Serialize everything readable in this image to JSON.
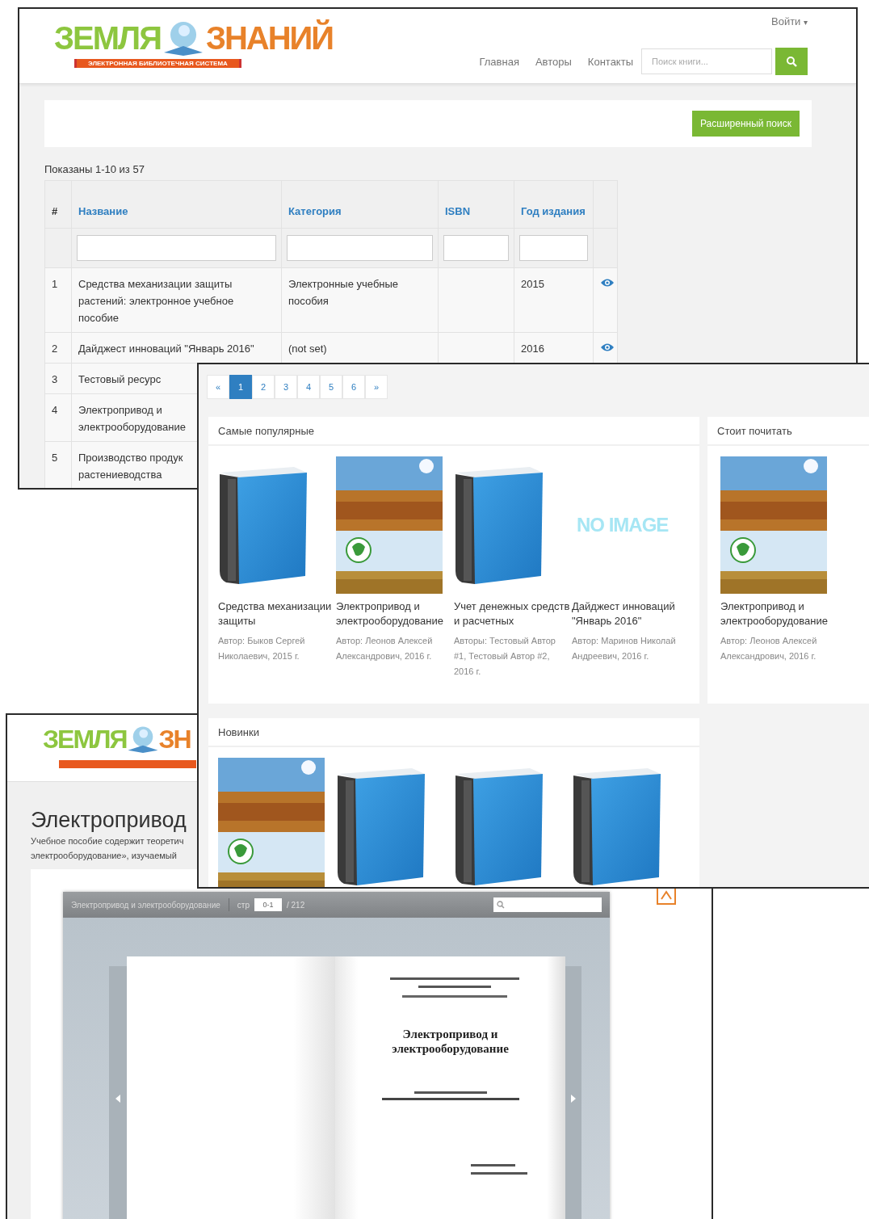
{
  "catalog_window": {
    "logo": {
      "first_word": "ЗЕМЛЯ",
      "second_word": "ЗНАНИЙ",
      "tagline": "ЭЛЕКТРОННАЯ БИБЛИОТЕЧНАЯ СИСТЕМА"
    },
    "login": "Войти",
    "login_caret": "▾",
    "nav": [
      "Главная",
      "Авторы",
      "Контакты"
    ],
    "search": {
      "placeholder": "Поиск книги..."
    },
    "advanced_search_button": "Расширенный поиск",
    "summary": "Показаны 1-10 из 57",
    "table": {
      "columns": [
        "#",
        "Название",
        "Категория",
        "ISBN",
        "Год издания"
      ],
      "rows": [
        {
          "num": "1",
          "title": "Средства механизации защиты растений: электронное учебное пособие",
          "category": "Электронные учебные пособия",
          "year": "2015"
        },
        {
          "num": "2",
          "title": "Дайджест инноваций \"Январь 2016\"",
          "category": "(not set)",
          "year": "2016"
        },
        {
          "num": "3",
          "title": "Тестовый ресурс"
        },
        {
          "num": "4",
          "title": "Электропривод и электрооборудование"
        },
        {
          "num": "5",
          "title": "Производство продук растениеводства"
        }
      ]
    }
  },
  "listing_window": {
    "pagination": [
      {
        "label": "«",
        "selected": false
      },
      {
        "label": "1",
        "selected": true
      },
      {
        "label": "2",
        "selected": false
      },
      {
        "label": "3",
        "selected": false
      },
      {
        "label": "4",
        "selected": false
      },
      {
        "label": "5",
        "selected": false
      },
      {
        "label": "6",
        "selected": false
      },
      {
        "label": "»",
        "selected": false
      }
    ],
    "panels": [
      {
        "title": "Самые популярные",
        "books": [
          {
            "kind": "blue_book",
            "title": "Средства механизации защиты",
            "author": "Автор: Быков Сергей Николаевич, 2015 г."
          },
          {
            "kind": "cover",
            "title": "Электропривод и электрооборудование",
            "author": "Автор: Леонов Алексей Александрович, 2016 г."
          },
          {
            "kind": "blue_book",
            "title": "Учет денежных средств и расчетных",
            "author": "Авторы: Тестовый Автор #1, Тестовый Автор #2, 2016 г."
          },
          {
            "kind": "no_image",
            "image_text": "NO IMAGE",
            "title": "Дайджест инноваций \"Январь 2016\"",
            "author": "Автор: Маринов Николай Андреевич, 2016 г."
          }
        ]
      },
      {
        "title": "Стоит почитать",
        "books": [
          {
            "kind": "cover",
            "title": "Электропривод и электрооборудование",
            "author": "Автор: Леонов Алексей Александрович, 2016 г."
          }
        ]
      },
      {
        "title": "Новинки",
        "books": [
          {
            "kind": "cover"
          },
          {
            "kind": "blue_book"
          },
          {
            "kind": "blue_book"
          },
          {
            "kind": "blue_book"
          }
        ]
      }
    ]
  },
  "book_window": {
    "logo": {
      "first_word": "ЗЕМЛЯ",
      "second_word": "ЗН"
    },
    "heading": "Электропривод",
    "description": [
      "Учебное пособие содержит теоретич",
      "электрооборудование», изучаемый"
    ],
    "viewer": {
      "title": "Электропривод и электрооборудование",
      "page_label": "стр",
      "page_value": "0-1",
      "page_total": "/ 212",
      "page_title": "Электропривод и электрооборудование"
    }
  }
}
